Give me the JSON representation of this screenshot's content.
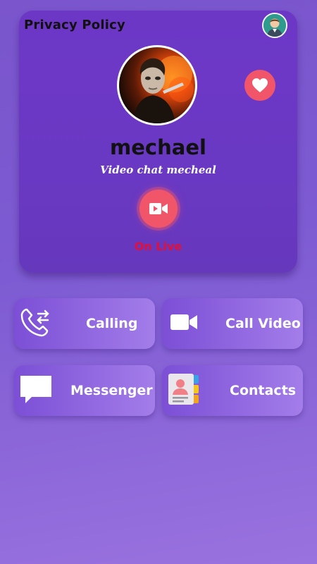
{
  "profile": {
    "privacy_label": "Privacy Policy",
    "name": "mechael",
    "tagline": "Video chat mecheal",
    "status": "On Live"
  },
  "actions": [
    {
      "label": "Calling",
      "icon": "phone-transfer-icon"
    },
    {
      "label": "Call Video",
      "icon": "video-camera-icon"
    },
    {
      "label": "Messenger",
      "icon": "chat-bubble-icon"
    },
    {
      "label": "Contacts",
      "icon": "contacts-book-icon"
    }
  ],
  "colors": {
    "card": "#6a39c4",
    "accent": "#f1556a",
    "live": "#e0103a"
  }
}
